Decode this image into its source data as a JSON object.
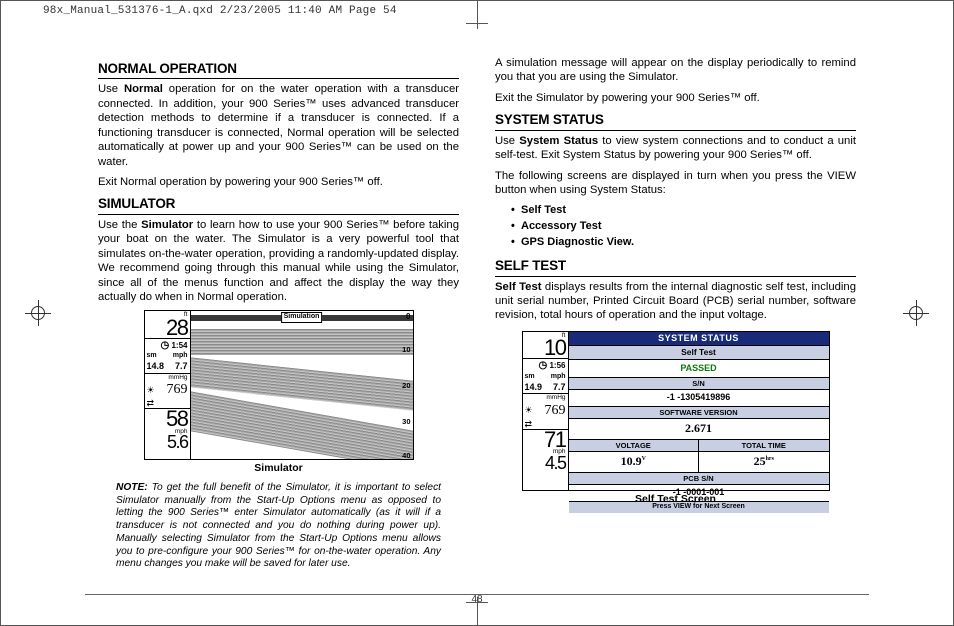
{
  "print_header": "98x_Manual_531376-1_A.qxd  2/23/2005  11:40 AM  Page 54",
  "page_number": "48",
  "left": {
    "sec1_title": "NORMAL OPERATION",
    "sec1_p1a": "Use ",
    "sec1_p1b": "Normal",
    "sec1_p1c": " operation for on the water operation with a transducer connected. In addition, your 900 Series™ uses advanced transducer detection methods to determine if a transducer is connected. If a functioning transducer is connected, Normal operation will be selected automatically at power up and your 900 Series™ can be used on the water.",
    "sec1_p2": "Exit Normal operation by powering your 900 Series™ off.",
    "sec2_title": "SIMULATOR",
    "sec2_p1a": "Use the ",
    "sec2_p1b": "Simulator",
    "sec2_p1c": " to learn how to use your 900 Series™ before taking your boat on the water. The Simulator is a very powerful tool that simulates on-the-water operation, providing a randomly-updated display. We recommend going through this manual while using the Simulator, since all of the menus function and affect the display the way they actually do when in Normal operation.",
    "sim_caption": "Simulator",
    "note_lead": "NOTE:",
    "note_body": " To get the full benefit of the Simulator, it is important to select Simulator manually from the Start-Up Options menu as opposed to letting the 900 Series™ enter Simulator automatically (as it will if a transducer is not connected and you do nothing during power up). Manually selecting Simulator from the Start-Up Options menu allows you to pre-configure your 900 Series™ for on-the-water operation. Any menu changes you make will be saved for later use.",
    "sim": {
      "unit_ft": "ft",
      "depth": "28",
      "time": "1:54",
      "sm": "sm",
      "mph": "mph",
      "sm_val": "14.8",
      "mph_val": "7.7",
      "mmhg": "mmHg",
      "baro": "769",
      "depth2": "58",
      "mph2": "mph",
      "speed2": "5.6",
      "overlay": "Simulation",
      "zero": "0",
      "t10": "10",
      "t20": "20",
      "t30": "30",
      "t40": "40"
    }
  },
  "right": {
    "intro1": "A simulation message will appear on the display periodically to remind you that you are using the Simulator.",
    "intro2": "Exit the Simulator by powering your 900 Series™ off.",
    "sec3_title": "SYSTEM STATUS",
    "sec3_p1a": "Use ",
    "sec3_p1b": "System Status",
    "sec3_p1c": " to view system connections and to conduct a unit self-test. Exit System Status by powering your 900 Series™ off.",
    "sec3_p2": "The following screens are displayed in turn when you press the VIEW button when using System Status:",
    "bullets": {
      "b1": "Self Test",
      "b2": "Accessory Test",
      "b3": "GPS Diagnostic View."
    },
    "sec4_title": "SELF TEST",
    "sec4_p1a": "Self Test",
    "sec4_p1b": " displays results from the internal diagnostic self test, including unit serial number, Printed Circuit Board (PCB) serial number, software revision, total hours of operation and the input voltage.",
    "st_caption": "Self Test Screen",
    "st": {
      "unit_ft": "ft",
      "depth": "10",
      "time": "1:56",
      "sm": "sm",
      "mph": "mph",
      "sm_val": "14.9",
      "mph_val": "7.7",
      "mmhg": "mmHg",
      "baro": "769",
      "temp": "71",
      "mph2": "mph",
      "speed2": "4.5",
      "titlebar": "SYSTEM STATUS",
      "subtitle": "Self Test",
      "passed": "PASSED",
      "sn_hdr": "S/N",
      "sn_val": "-1 -1305419896",
      "sw_hdr": "SOFTWARE VERSION",
      "sw_val": "2.671",
      "volt_hdr": "VOLTAGE",
      "volt_val": "10.9",
      "volt_unit": "V",
      "time_hdr": "TOTAL TIME",
      "time_val": "25",
      "time_unit": "hrs",
      "pcb_hdr": "PCB S/N",
      "pcb_val": "-1 -0001-001",
      "footer": "Press VIEW for Next Screen"
    }
  }
}
